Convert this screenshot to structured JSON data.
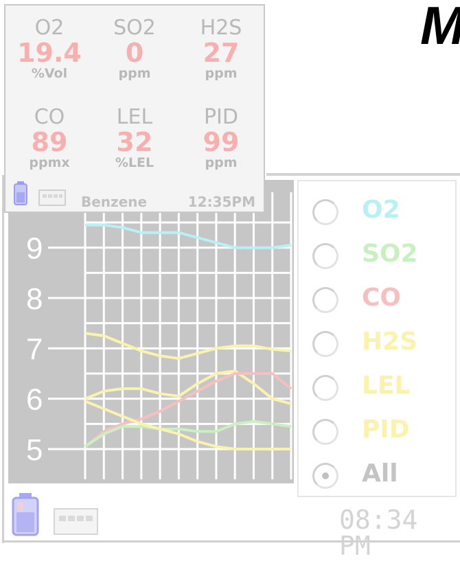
{
  "title_fragment": "M",
  "readout": {
    "gases": [
      {
        "name": "O2",
        "value": "19.4",
        "unit": "%Vol"
      },
      {
        "name": "SO2",
        "value": "0",
        "unit": "ppm"
      },
      {
        "name": "H2S",
        "value": "27",
        "unit": "ppm"
      },
      {
        "name": "CO",
        "value": "89",
        "unit": "ppmx"
      },
      {
        "name": "LEL",
        "value": "32",
        "unit": "%LEL"
      },
      {
        "name": "PID",
        "value": "99",
        "unit": "ppm"
      }
    ],
    "compound": "Benzene",
    "time": "12:35PM"
  },
  "chart": {
    "y_ticks": [
      "9",
      "8",
      "7",
      "6",
      "5"
    ],
    "ylim": [
      4.4,
      10.1
    ],
    "series": [
      {
        "name": "O2",
        "color": "#b8f0f4",
        "values": [
          9.45,
          9.45,
          9.4,
          9.3,
          9.3,
          9.3,
          9.2,
          9.1,
          9.0,
          9.0,
          9.0,
          9.05
        ]
      },
      {
        "name": "H2S",
        "color": "#fbf2ad",
        "values": [
          7.3,
          7.25,
          7.1,
          6.95,
          6.85,
          6.8,
          6.9,
          7.0,
          7.05,
          7.05,
          6.98,
          6.95
        ]
      },
      {
        "name": "LEL",
        "color": "#fbf2ad",
        "values": [
          6.0,
          6.15,
          6.2,
          6.2,
          6.1,
          6.05,
          6.3,
          6.5,
          6.55,
          6.3,
          6.0,
          5.9
        ]
      },
      {
        "name": "CO",
        "color": "#f6c0c0",
        "values": [
          5.05,
          5.35,
          5.5,
          5.6,
          5.75,
          5.95,
          6.15,
          6.35,
          6.5,
          6.5,
          6.5,
          6.2
        ]
      },
      {
        "name": "SO2",
        "color": "#c8f0c0",
        "values": [
          5.05,
          5.3,
          5.45,
          5.45,
          5.4,
          5.4,
          5.35,
          5.35,
          5.5,
          5.55,
          5.5,
          5.45
        ]
      },
      {
        "name": "PID",
        "color": "#fbf2ad",
        "values": [
          5.95,
          5.8,
          5.65,
          5.5,
          5.4,
          5.3,
          5.15,
          5.05,
          5.0,
          5.0,
          5.0,
          5.0
        ]
      }
    ]
  },
  "legend": {
    "items": [
      {
        "label": "O2",
        "color": "#b8f0f4",
        "selected": false
      },
      {
        "label": "SO2",
        "color": "#c8f0c0",
        "selected": false
      },
      {
        "label": "CO",
        "color": "#f6c0c0",
        "selected": false
      },
      {
        "label": "H2S",
        "color": "#fbf2ad",
        "selected": false
      },
      {
        "label": "LEL",
        "color": "#fbf2ad",
        "selected": false
      },
      {
        "label": "PID",
        "color": "#fbf2ad",
        "selected": false
      },
      {
        "label": "All",
        "color": "#c4c4c4",
        "selected": true
      }
    ]
  },
  "status": {
    "time": "08:34 PM",
    "battery_icon": "battery-icon",
    "memory_icon": "memory-card-icon"
  },
  "colors": {
    "value_red": "#f6b0b0",
    "chart_bg": "#c6c6c6"
  }
}
